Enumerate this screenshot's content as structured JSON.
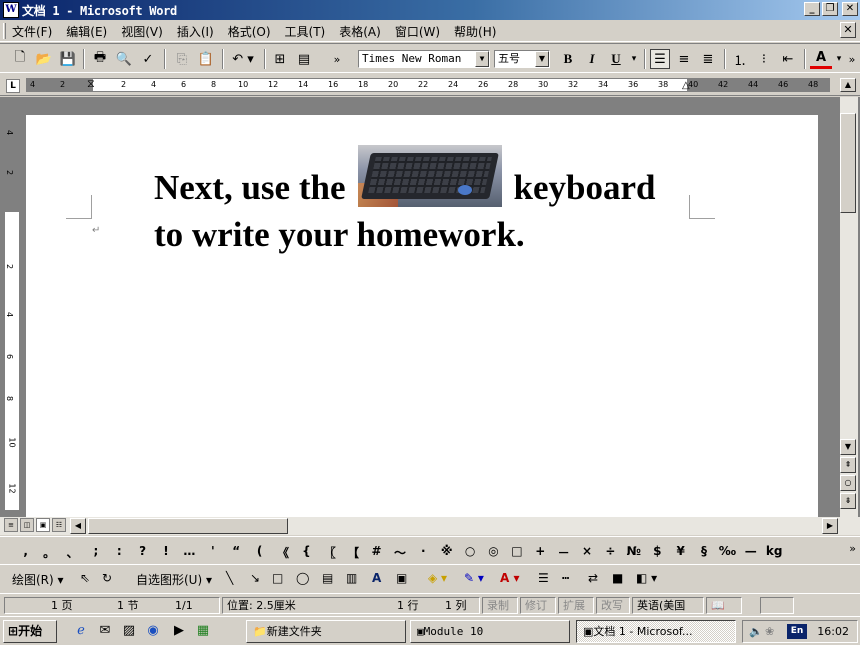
{
  "window": {
    "title": "文档 1 - Microsoft Word",
    "app_icon": "W"
  },
  "menu": {
    "items": [
      "文件(F)",
      "编辑(E)",
      "视图(V)",
      "插入(I)",
      "格式(O)",
      "工具(T)",
      "表格(A)",
      "窗口(W)",
      "帮助(H)"
    ]
  },
  "toolbar": {
    "font_name": "Times New Roman",
    "font_size": "五号",
    "bold": "B",
    "italic": "I",
    "underline": "U",
    "font_color": "A"
  },
  "ruler": {
    "numbers": [
      "4",
      "2",
      "2",
      "4",
      "6",
      "8",
      "10",
      "12",
      "14",
      "16",
      "18",
      "20",
      "22",
      "24",
      "26",
      "28",
      "30",
      "32",
      "34",
      "36",
      "38",
      "40",
      "42",
      "44",
      "46",
      "48"
    ],
    "vertical_numbers": [
      "4",
      "2",
      "2",
      "4",
      "6",
      "8",
      "10",
      "12"
    ]
  },
  "document": {
    "line1_before": "Next, use the",
    "line1_after": "keyboard",
    "line2": "to write your homework.",
    "image": "keyboard-photo"
  },
  "symbols": [
    ",",
    "。",
    "、",
    ";",
    ":",
    "?",
    "!",
    "…",
    "'",
    "“",
    "(",
    "《",
    "{",
    "〖",
    "【",
    "#",
    "～",
    "·",
    "※",
    "○",
    "◎",
    "□",
    "+",
    "－",
    "×",
    "÷",
    "№",
    "$",
    "¥",
    "§",
    "‰",
    "—",
    "kg"
  ],
  "drawing": {
    "draw_label": "绘图(R)",
    "autoshapes_label": "自选图形(U)"
  },
  "status": {
    "page": "1 页",
    "section": "1 节",
    "page_of": "1/1",
    "position": "位置: 2.5厘米",
    "line": "1 行",
    "column": "1 列",
    "rec": "录制",
    "trk": "修订",
    "ext": "扩展",
    "ovr": "改写",
    "language": "英语(美国"
  },
  "taskbar": {
    "start": "开始",
    "tasks": [
      "新建文件夹",
      "Module 10",
      "文档 1 - Microsof..."
    ],
    "lang_indicator": "En",
    "clock": "16:02"
  }
}
